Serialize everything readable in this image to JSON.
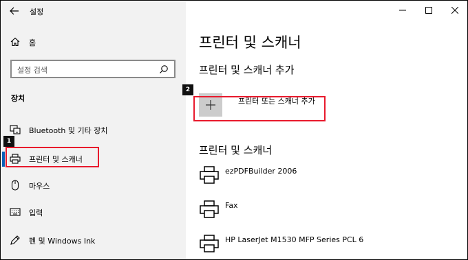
{
  "window": {
    "title": "설정",
    "controls": [
      "minimize-icon",
      "maximize-icon",
      "close-icon"
    ]
  },
  "sidebar": {
    "home_label": "홈",
    "search_placeholder": "설정 검색",
    "section_label": "장치",
    "items": [
      {
        "label": "Bluetooth 및 기타 장치",
        "icon": "bluetooth-devices-icon"
      },
      {
        "label": "프린터 및 스캐너",
        "icon": "printer-icon",
        "selected": true
      },
      {
        "label": "마우스",
        "icon": "mouse-icon"
      },
      {
        "label": "입력",
        "icon": "keyboard-icon"
      },
      {
        "label": "펜 및 Windows Ink",
        "icon": "pen-icon"
      }
    ]
  },
  "main": {
    "page_title": "프린터 및 스캐너",
    "add_section_title": "프린터 및 스캐너 추가",
    "add_button_label": "프린터 또는 스캐너 추가",
    "list_section_title": "프린터 및 스캐너",
    "printers": [
      {
        "name": "ezPDFBuilder 2006"
      },
      {
        "name": "Fax"
      },
      {
        "name": "HP LaserJet M1530 MFP Series PCL 6"
      }
    ]
  },
  "annotations": [
    {
      "label": "1"
    },
    {
      "label": "2"
    }
  ],
  "colors": {
    "sidebar_bg": "#f2f2f2",
    "accent": "#0a60b8",
    "callout": "#e8192c",
    "add_tile": "#cccccc"
  }
}
